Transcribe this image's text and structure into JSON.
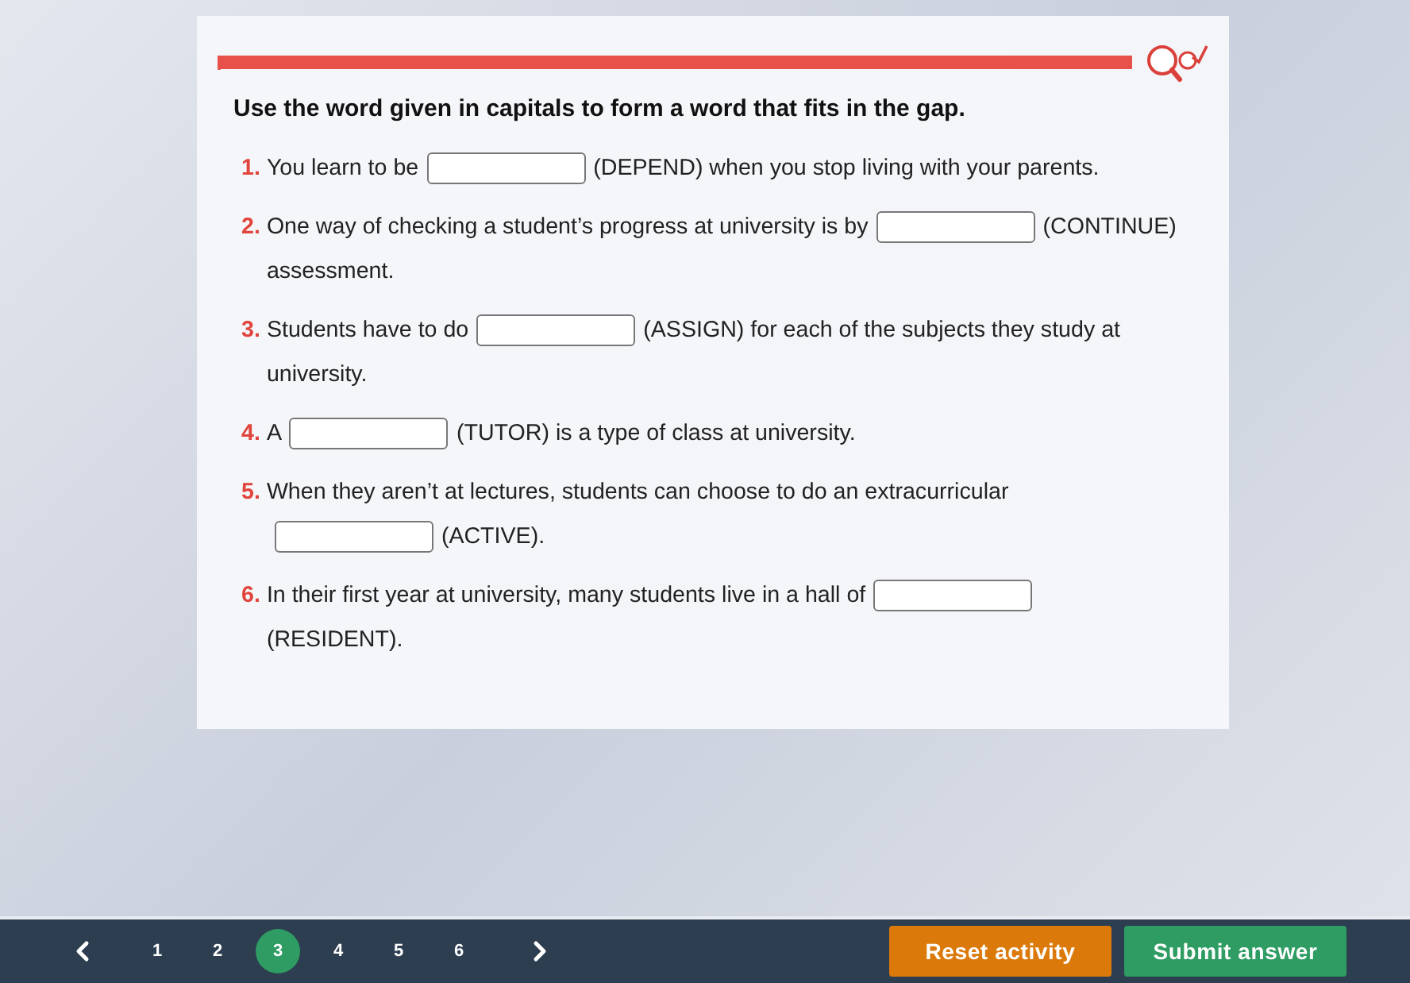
{
  "instruction": "Use the word given in capitals to form a word that fits in the gap.",
  "items": [
    {
      "number": "1.",
      "parts": [
        {
          "kind": "text",
          "text": "You learn to be"
        },
        {
          "kind": "gap"
        },
        {
          "kind": "text",
          "text": "(DEPEND) when you stop living with your parents."
        }
      ]
    },
    {
      "number": "2.",
      "parts": [
        {
          "kind": "text",
          "text": "One way of checking a student’s progress at university is by"
        },
        {
          "kind": "gap"
        },
        {
          "kind": "text",
          "text": "(CONTINUE)"
        },
        {
          "kind": "break"
        },
        {
          "kind": "text",
          "text": "assessment."
        }
      ]
    },
    {
      "number": "3.",
      "parts": [
        {
          "kind": "text",
          "text": "Students have to do"
        },
        {
          "kind": "gap"
        },
        {
          "kind": "text",
          "text": "(ASSIGN) for each of the subjects they study at"
        },
        {
          "kind": "break"
        },
        {
          "kind": "text",
          "text": "university."
        }
      ]
    },
    {
      "number": "4.",
      "parts": [
        {
          "kind": "text",
          "text": "A"
        },
        {
          "kind": "gap"
        },
        {
          "kind": "text",
          "text": "(TUTOR) is a type of class at university."
        }
      ]
    },
    {
      "number": "5.",
      "parts": [
        {
          "kind": "text",
          "text": "When they aren’t at lectures, students can choose to do an extracurricular"
        },
        {
          "kind": "break"
        },
        {
          "kind": "gap"
        },
        {
          "kind": "text",
          "text": "(ACTIVE)."
        }
      ]
    },
    {
      "number": "6.",
      "parts": [
        {
          "kind": "text",
          "text": "In their first year at university, many students live in a hall of"
        },
        {
          "kind": "gap"
        },
        {
          "kind": "break"
        },
        {
          "kind": "text",
          "text": "(RESIDENT)."
        }
      ]
    }
  ],
  "pager": [
    {
      "label": "1",
      "selected": false
    },
    {
      "label": "2",
      "selected": false
    },
    {
      "label": "3",
      "selected": true
    },
    {
      "label": "4",
      "selected": false
    },
    {
      "label": "5",
      "selected": false
    },
    {
      "label": "6",
      "selected": false
    }
  ],
  "buttons": [
    {
      "label": "Reset activity",
      "kind": "reset"
    },
    {
      "label": "Submit answer",
      "kind": "submit"
    }
  ]
}
